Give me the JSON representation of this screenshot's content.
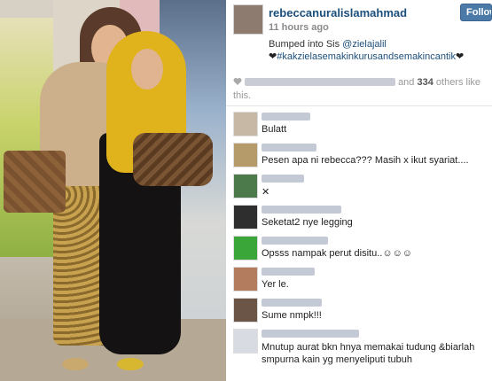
{
  "post": {
    "username": "rebeccanuralislamahmad",
    "follow_label": "Follow",
    "timestamp": "11 hours ago",
    "caption_prefix": "Bumped into Sis ",
    "caption_mention": "@zielajalil",
    "hashtag": "#kakzielasemakinkurusandsemakincantik",
    "likes_suffix_pre": "and ",
    "likes_count": "334",
    "likes_suffix_post": " others like this."
  },
  "comments": [
    {
      "text": "Bulatt",
      "avatar_color": "#c7b7a5"
    },
    {
      "text": "Pesen apa ni rebecca??? Masih x ikut syariat....",
      "avatar_color": "#b59a6a"
    },
    {
      "text": "✕",
      "avatar_color": "#4d7a4a"
    },
    {
      "text": "Seketat2 nye legging",
      "avatar_color": "#2e2e2e"
    },
    {
      "text": "Opsss nampak perut disitu..☺☺☺",
      "avatar_color": "#3aa63a"
    },
    {
      "text": "Yer le.",
      "avatar_color": "#b47c5e"
    },
    {
      "text": "Sume nmpk!!!",
      "avatar_color": "#6b5546"
    },
    {
      "text": "Mnutup aurat bkn hnya memakai tudung &biarlah smpurna kain yg menyeliputi tubuh",
      "avatar_color": "#d9dbe3"
    }
  ],
  "colors": {
    "link": "#1c4f7c",
    "follow_bg": "#4c7aa8"
  }
}
